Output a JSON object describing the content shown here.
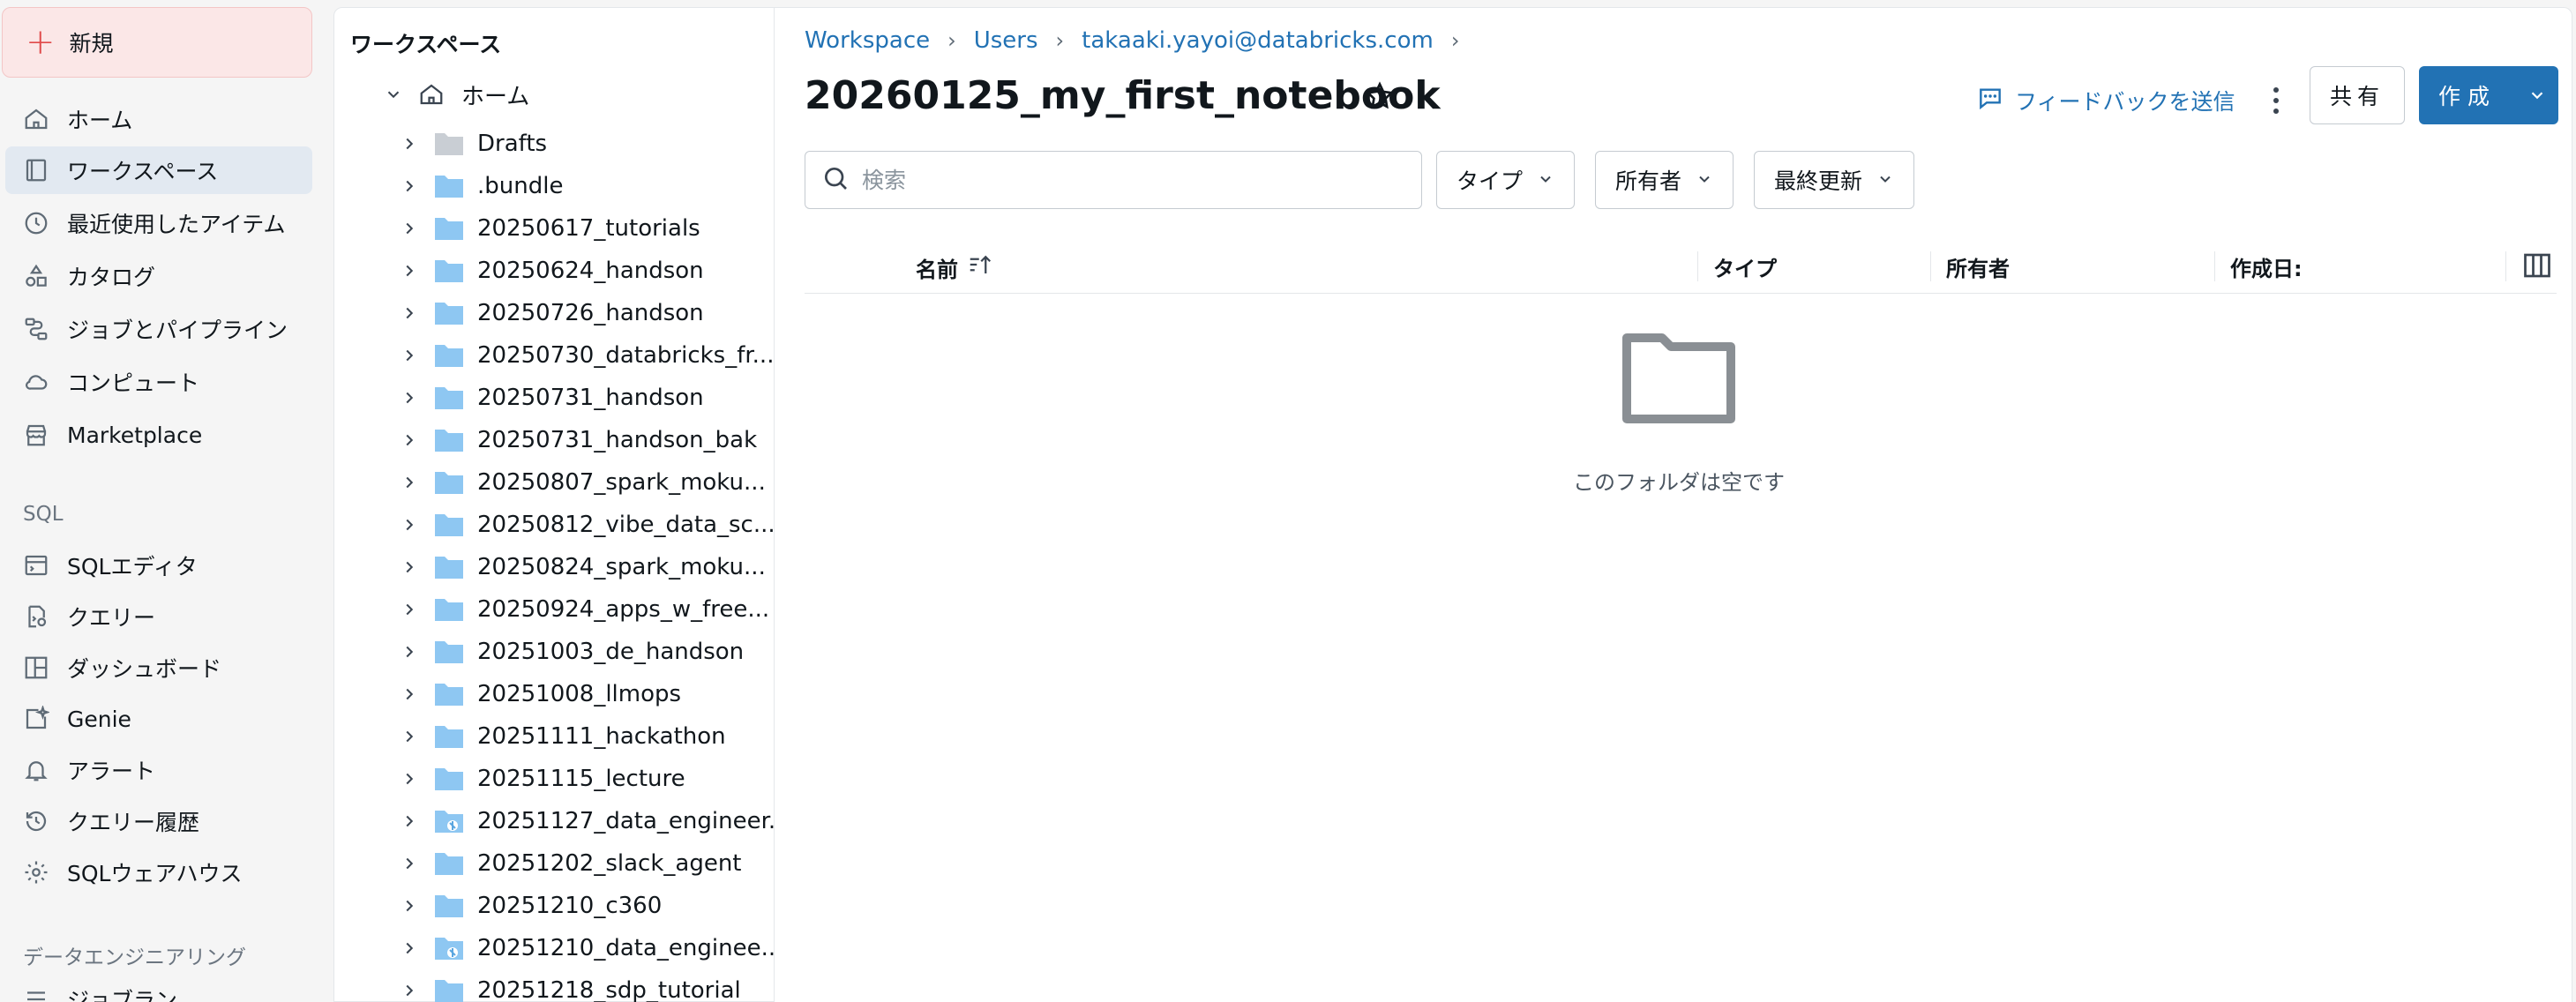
{
  "leftnav": {
    "new_label": "新規",
    "items": [
      {
        "label": "ホーム",
        "icon": "home-icon"
      },
      {
        "label": "ワークスペース",
        "icon": "workspace-icon",
        "active": true
      },
      {
        "label": "最近使用したアイテム",
        "icon": "clock-icon"
      },
      {
        "label": "カタログ",
        "icon": "catalog-icon"
      },
      {
        "label": "ジョブとパイプライン",
        "icon": "workflow-icon"
      },
      {
        "label": "コンピュート",
        "icon": "cloud-icon"
      },
      {
        "label": "Marketplace",
        "icon": "store-icon"
      }
    ],
    "sql_section": "SQL",
    "sql_items": [
      {
        "label": "SQLエディタ",
        "icon": "sql-editor-icon"
      },
      {
        "label": "クエリー",
        "icon": "query-icon"
      },
      {
        "label": "ダッシュボード",
        "icon": "dashboard-icon"
      },
      {
        "label": "Genie",
        "icon": "genie-icon"
      },
      {
        "label": "アラート",
        "icon": "bell-icon"
      },
      {
        "label": "クエリー履歴",
        "icon": "history-icon"
      },
      {
        "label": "SQLウェアハウス",
        "icon": "warehouse-icon"
      }
    ],
    "de_section": "データエンジニアリング",
    "de_partial_item": "ジョブラン"
  },
  "tree": {
    "title": "ワークスペース",
    "home_label": "ホーム",
    "items": [
      {
        "label": "Drafts",
        "type": "gray"
      },
      {
        "label": ".bundle",
        "type": "blue"
      },
      {
        "label": "20250617_tutorials",
        "type": "blue"
      },
      {
        "label": "20250624_handson",
        "type": "blue"
      },
      {
        "label": "20250726_handson",
        "type": "blue"
      },
      {
        "label": "20250730_databricks_fr...",
        "type": "blue"
      },
      {
        "label": "20250731_handson",
        "type": "blue"
      },
      {
        "label": "20250731_handson_bak",
        "type": "blue"
      },
      {
        "label": "20250807_spark_moku...",
        "type": "blue"
      },
      {
        "label": "20250812_vibe_data_sc...",
        "type": "blue"
      },
      {
        "label": "20250824_spark_moku...",
        "type": "blue"
      },
      {
        "label": "20250924_apps_w_free...",
        "type": "blue"
      },
      {
        "label": "20251003_de_handson",
        "type": "blue"
      },
      {
        "label": "20251008_llmops",
        "type": "blue"
      },
      {
        "label": "20251111_hackathon",
        "type": "blue"
      },
      {
        "label": "20251115_lecture",
        "type": "blue"
      },
      {
        "label": "20251127_data_engineer...",
        "type": "git"
      },
      {
        "label": "20251202_slack_agent",
        "type": "blue"
      },
      {
        "label": "20251210_c360",
        "type": "blue"
      },
      {
        "label": "20251210_data_enginee...",
        "type": "git"
      },
      {
        "label": "20251218_sdp_tutorial",
        "type": "blue"
      }
    ]
  },
  "main": {
    "breadcrumb": [
      "Workspace",
      "Users",
      "takaaki.yayoi@databricks.com"
    ],
    "title": "20260125_my_first_notebook",
    "feedback_label": "フィードバックを送信",
    "share_label": "共有",
    "create_label": "作成",
    "search_placeholder": "検索",
    "filters": [
      "タイプ",
      "所有者",
      "最終更新"
    ],
    "columns": [
      "名前",
      "タイプ",
      "所有者",
      "作成日:"
    ],
    "empty_message": "このフォルダは空です"
  },
  "colors": {
    "accent": "#2272b4",
    "active_bg": "#e2e9f1",
    "new_bg": "#fbe7e7",
    "folder_blue": "#8ec7f2",
    "folder_gray": "#c9ced4"
  }
}
